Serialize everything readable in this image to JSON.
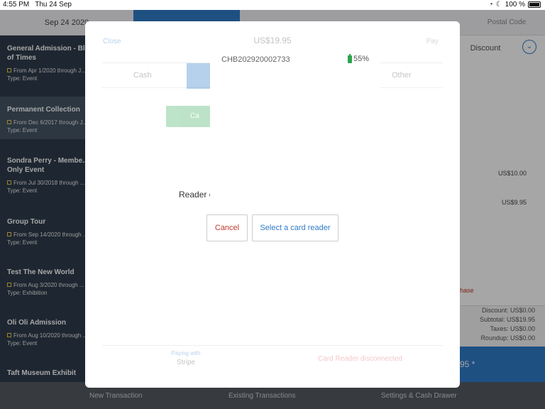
{
  "status": {
    "time": "4:55 PM",
    "date": "Thu 24 Sep",
    "battery": "100 %"
  },
  "topbar": {
    "date": "Sep 24 2020",
    "postal": "Postal Code"
  },
  "sidebar": {
    "items": [
      {
        "title": "General Admission - Bl... of Times",
        "sub": "From Apr 1/2020 through J...",
        "type": "Type: Event"
      },
      {
        "title": "Permanent Collection",
        "sub": "From Dec 6/2017 through J...",
        "type": "Type: Event"
      },
      {
        "title": "Sondra Perry - Membe... Only Event",
        "sub": "From Jul 30/2018 through ...",
        "type": "Type: Event"
      },
      {
        "title": "Group Tour",
        "sub": "From Sep 14/2020 through ...",
        "type": "Type: Event"
      },
      {
        "title": "Test The New World",
        "sub": "From Aug 3/2020 through ...",
        "type": "Type: Exhibition"
      },
      {
        "title": "Oli Oli Admission",
        "sub": "From Aug 10/2020 through ...",
        "type": "Type: Event"
      },
      {
        "title": "Taft Museum Exhibit",
        "sub": "",
        "type": ""
      }
    ]
  },
  "right": {
    "discount": "Discount",
    "line1": "US$10.00",
    "line2": "US$9.95",
    "purchase": "hase",
    "summary": [
      "Discount: US$0.00",
      "Subtotal: US$19.95",
      "Taxes: US$0.00",
      "Roundup: US$0.00"
    ],
    "pay_total": "95 *"
  },
  "bottom": {
    "new": "New Transaction",
    "existing": "Existing Transactions",
    "settings": "Settings & Cash Drawer"
  },
  "modal": {
    "close": "Close",
    "title": "US$19.95",
    "pay": "Pay",
    "tab_cash": "Cash",
    "tab_other": "Other",
    "card_btn": "Ca",
    "reader_text": "Reader c",
    "cancel": "Cancel",
    "select_reader": "Select a card reader",
    "paying_with": "Paying with",
    "paying_provider": "Stripe",
    "reader_status": "Card Reader disconnected"
  },
  "popover": {
    "reader_id": "CHB202920002733",
    "battery": "55%"
  }
}
